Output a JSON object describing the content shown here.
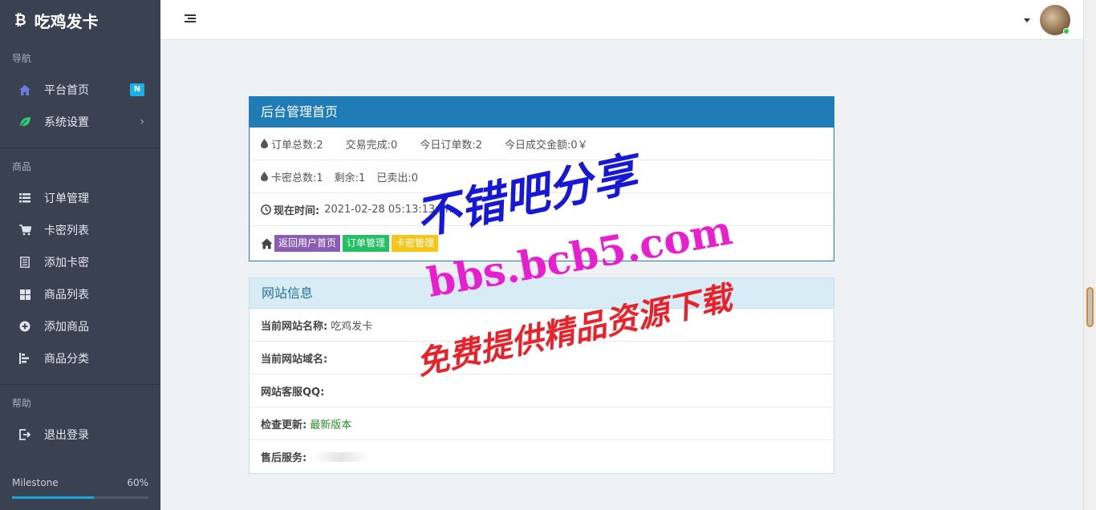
{
  "brand": {
    "title": "吃鸡发卡",
    "icon": "bitcoin-icon"
  },
  "sidebar": {
    "sections": [
      {
        "heading": "导航"
      },
      {
        "heading": "商品"
      },
      {
        "heading": "帮助"
      }
    ],
    "nav": [
      {
        "label": "平台首页",
        "icon": "home-icon",
        "badge": "N"
      },
      {
        "label": "系统设置",
        "icon": "leaf-icon",
        "chevron": "›"
      }
    ],
    "goods": [
      {
        "label": "订单管理",
        "icon": "list-icon"
      },
      {
        "label": "卡密列表",
        "icon": "cart-icon"
      },
      {
        "label": "添加卡密",
        "icon": "document-icon"
      },
      {
        "label": "商品列表",
        "icon": "grid-icon"
      },
      {
        "label": "添加商品",
        "icon": "plus-circle-icon"
      },
      {
        "label": "商品分类",
        "icon": "sort-icon"
      }
    ],
    "help": [
      {
        "label": "退出登录",
        "icon": "logout-icon"
      }
    ],
    "milestone": {
      "label": "Milestone",
      "percent_text": "60%",
      "progress": 0.6
    }
  },
  "topbar": {
    "menu_icon": "menu-icon",
    "caret_icon": "caret-down-icon",
    "avatar": "avatar"
  },
  "admin_panel": {
    "title": "后台管理首页",
    "stats_row1": [
      "订单总数:2",
      "交易完成:0",
      "今日订单数:2",
      "今日成交金额:0￥"
    ],
    "stats_row2": [
      "卡密总数:1",
      "剩余:1",
      "已卖出:0"
    ],
    "time_label": "现在时间:",
    "time_value": "2021-02-28 05:13:13pm",
    "buttons": [
      "返回用户首页",
      "订单管理",
      "卡密管理"
    ]
  },
  "site_panel": {
    "title": "网站信息",
    "rows": [
      {
        "label": "当前网站名称:",
        "value": "吃鸡发卡"
      },
      {
        "label": "当前网站域名:",
        "value": ""
      },
      {
        "label": "网站客服QQ:",
        "value": ""
      },
      {
        "label": "检查更新:",
        "value": "最新版本"
      },
      {
        "label": "售后服务:",
        "value": ""
      }
    ]
  },
  "watermark": {
    "line1": "不错吧分享",
    "line2": "bbs.bcb5.com",
    "line3": "免费提供精品资源下载"
  },
  "colors": {
    "sidebar_bg": "#3a4150",
    "primary": "#1f7cb6",
    "info_bg": "#d8ecf6",
    "badge": "#1ab2e6",
    "btn_purple": "#8a5cb3",
    "btn_green": "#22c063",
    "btn_yellow": "#f5c518"
  }
}
